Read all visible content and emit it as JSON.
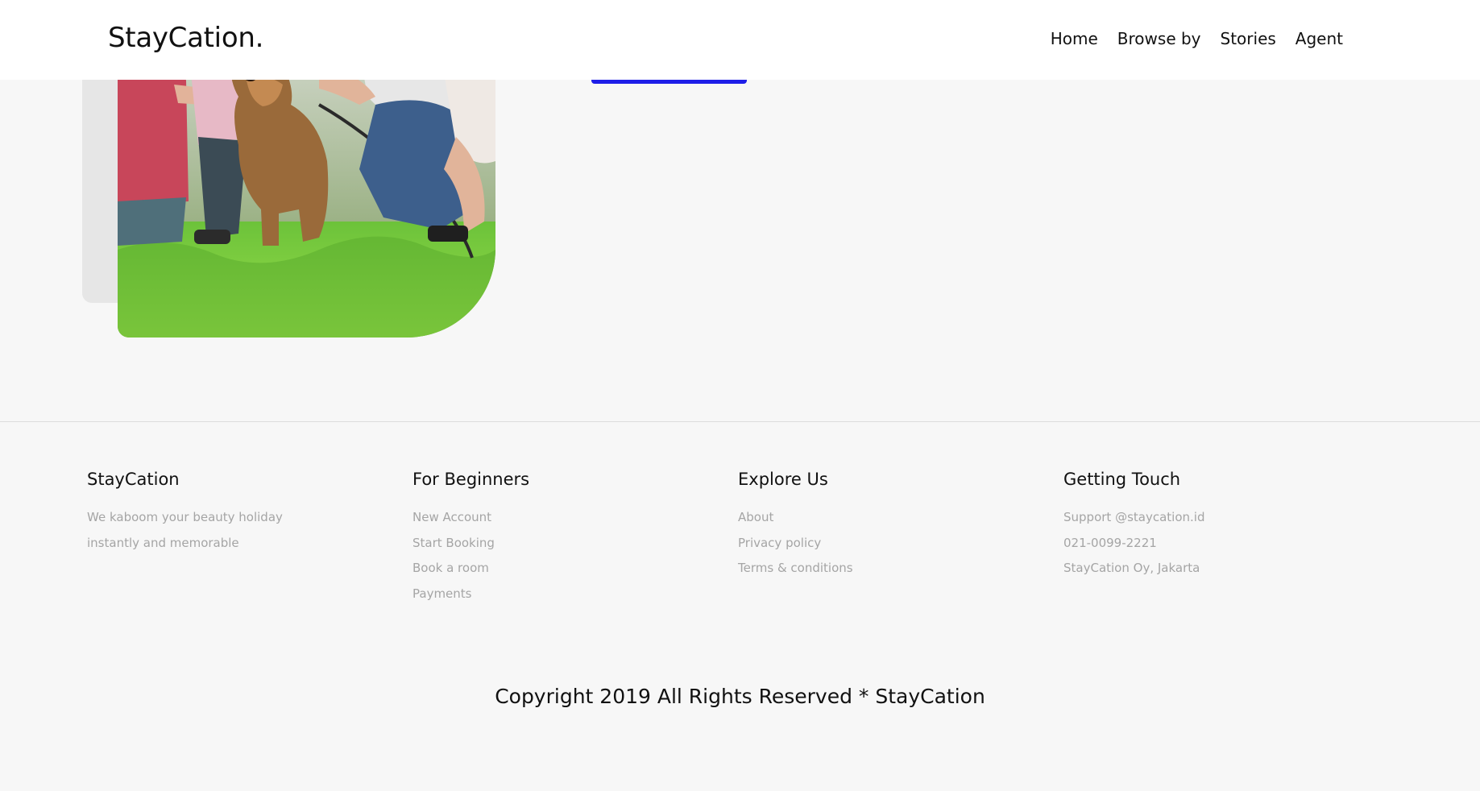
{
  "header": {
    "brand": "StayCation.",
    "nav": [
      "Home",
      "Browse by",
      "Stories",
      "Agent"
    ]
  },
  "colors": {
    "accent": "#1e1ee8",
    "background": "#f7f7f7",
    "muted_text": "#a5a5a5"
  },
  "footer": {
    "columns": [
      {
        "title": "StayCation",
        "items": [
          "We kaboom your beauty holiday",
          "instantly and memorable"
        ]
      },
      {
        "title": "For Beginners",
        "items": [
          "New Account",
          "Start Booking",
          "Book a room",
          "Payments"
        ]
      },
      {
        "title": "Explore Us",
        "items": [
          "About",
          "Privacy policy",
          "Terms & conditions"
        ]
      },
      {
        "title": "Getting Touch",
        "items": [
          "Support @staycation.id",
          "021-0099-2221",
          "StayCation Oy, Jakarta"
        ]
      }
    ],
    "copyright": "Copyright 2019 All Rights Reserved * StayCation"
  }
}
